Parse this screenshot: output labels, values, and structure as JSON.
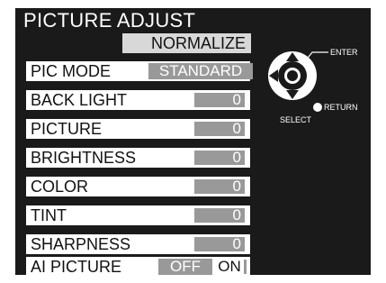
{
  "menu": {
    "title": "PICTURE ADJUST",
    "normalize_label": "NORMALIZE",
    "pic_mode": {
      "label": "PIC MODE",
      "value": "STANDARD"
    },
    "items": [
      {
        "label": "BACK LIGHT",
        "value": "0"
      },
      {
        "label": "PICTURE",
        "value": "0"
      },
      {
        "label": "BRIGHTNESS",
        "value": "0"
      },
      {
        "label": "COLOR",
        "value": "0"
      },
      {
        "label": "TINT",
        "value": "0"
      },
      {
        "label": "SHARPNESS",
        "value": "0"
      }
    ],
    "ai_picture": {
      "label": "AI PICTURE",
      "off_label": "OFF",
      "on_label": "ON"
    }
  },
  "remote_guide": {
    "enter_label": "ENTER",
    "return_label": "RETURN",
    "select_label": "SELECT"
  },
  "colors": {
    "background": "#1a1a1a",
    "row_bg": "#ffffff",
    "value_bg": "#999999",
    "text_light": "#ffffff"
  }
}
